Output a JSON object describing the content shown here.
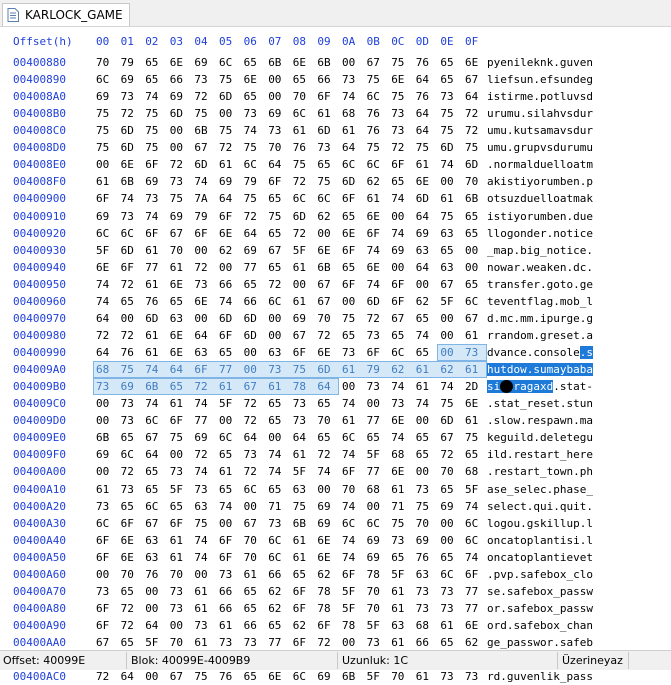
{
  "tab": {
    "title": "KARLOCK_GAME",
    "icon": "document-icon"
  },
  "header": {
    "offset_label": "Offset(h)",
    "columns": [
      "00",
      "01",
      "02",
      "03",
      "04",
      "05",
      "06",
      "07",
      "08",
      "09",
      "0A",
      "0B",
      "0C",
      "0D",
      "0E",
      "0F"
    ]
  },
  "rows": [
    {
      "offset": "00400880",
      "bytes": [
        "70",
        "79",
        "65",
        "6E",
        "69",
        "6C",
        "65",
        "6B",
        "6E",
        "6B",
        "00",
        "67",
        "75",
        "76",
        "65",
        "6E"
      ],
      "ascii": "pyenileknk.guven"
    },
    {
      "offset": "00400890",
      "bytes": [
        "6C",
        "69",
        "65",
        "66",
        "73",
        "75",
        "6E",
        "00",
        "65",
        "66",
        "73",
        "75",
        "6E",
        "64",
        "65",
        "67"
      ],
      "ascii": "liefsun.efsundeg"
    },
    {
      "offset": "004008A0",
      "bytes": [
        "69",
        "73",
        "74",
        "69",
        "72",
        "6D",
        "65",
        "00",
        "70",
        "6F",
        "74",
        "6C",
        "75",
        "76",
        "73",
        "64"
      ],
      "ascii": "istirme.potluvsd"
    },
    {
      "offset": "004008B0",
      "bytes": [
        "75",
        "72",
        "75",
        "6D",
        "75",
        "00",
        "73",
        "69",
        "6C",
        "61",
        "68",
        "76",
        "73",
        "64",
        "75",
        "72"
      ],
      "ascii": "urumu.silahvsdur"
    },
    {
      "offset": "004008C0",
      "bytes": [
        "75",
        "6D",
        "75",
        "00",
        "6B",
        "75",
        "74",
        "73",
        "61",
        "6D",
        "61",
        "76",
        "73",
        "64",
        "75",
        "72"
      ],
      "ascii": "umu.kutsamavsdur"
    },
    {
      "offset": "004008D0",
      "bytes": [
        "75",
        "6D",
        "75",
        "00",
        "67",
        "72",
        "75",
        "70",
        "76",
        "73",
        "64",
        "75",
        "72",
        "75",
        "6D",
        "75"
      ],
      "ascii": "umu.grupvsdurumu"
    },
    {
      "offset": "004008E0",
      "bytes": [
        "00",
        "6E",
        "6F",
        "72",
        "6D",
        "61",
        "6C",
        "64",
        "75",
        "65",
        "6C",
        "6C",
        "6F",
        "61",
        "74",
        "6D"
      ],
      "ascii": ".normalduelloatm"
    },
    {
      "offset": "004008F0",
      "bytes": [
        "61",
        "6B",
        "69",
        "73",
        "74",
        "69",
        "79",
        "6F",
        "72",
        "75",
        "6D",
        "62",
        "65",
        "6E",
        "00",
        "70"
      ],
      "ascii": "akistiyorumben.p"
    },
    {
      "offset": "00400900",
      "bytes": [
        "6F",
        "74",
        "73",
        "75",
        "7A",
        "64",
        "75",
        "65",
        "6C",
        "6C",
        "6F",
        "61",
        "74",
        "6D",
        "61",
        "6B"
      ],
      "ascii": "otsuzduelloatmak"
    },
    {
      "offset": "00400910",
      "bytes": [
        "69",
        "73",
        "74",
        "69",
        "79",
        "6F",
        "72",
        "75",
        "6D",
        "62",
        "65",
        "6E",
        "00",
        "64",
        "75",
        "65"
      ],
      "ascii": "istiyorumben.due"
    },
    {
      "offset": "00400920",
      "bytes": [
        "6C",
        "6C",
        "6F",
        "67",
        "6F",
        "6E",
        "64",
        "65",
        "72",
        "00",
        "6E",
        "6F",
        "74",
        "69",
        "63",
        "65"
      ],
      "ascii": "llogonder.notice"
    },
    {
      "offset": "00400930",
      "bytes": [
        "5F",
        "6D",
        "61",
        "70",
        "00",
        "62",
        "69",
        "67",
        "5F",
        "6E",
        "6F",
        "74",
        "69",
        "63",
        "65",
        "00"
      ],
      "ascii": "_map.big_notice."
    },
    {
      "offset": "00400940",
      "bytes": [
        "6E",
        "6F",
        "77",
        "61",
        "72",
        "00",
        "77",
        "65",
        "61",
        "6B",
        "65",
        "6E",
        "00",
        "64",
        "63",
        "00"
      ],
      "ascii": "nowar.weaken.dc."
    },
    {
      "offset": "00400950",
      "bytes": [
        "74",
        "72",
        "61",
        "6E",
        "73",
        "66",
        "65",
        "72",
        "00",
        "67",
        "6F",
        "74",
        "6F",
        "00",
        "67",
        "65"
      ],
      "ascii": "transfer.goto.ge"
    },
    {
      "offset": "00400960",
      "bytes": [
        "74",
        "65",
        "76",
        "65",
        "6E",
        "74",
        "66",
        "6C",
        "61",
        "67",
        "00",
        "6D",
        "6F",
        "62",
        "5F",
        "6C"
      ],
      "ascii": "teventflag.mob_l"
    },
    {
      "offset": "00400970",
      "bytes": [
        "64",
        "00",
        "6D",
        "63",
        "00",
        "6D",
        "6D",
        "00",
        "69",
        "70",
        "75",
        "72",
        "67",
        "65",
        "00",
        "67"
      ],
      "ascii": "d.mc.mm.ipurge.g"
    },
    {
      "offset": "00400980",
      "bytes": [
        "72",
        "72",
        "61",
        "6E",
        "64",
        "6F",
        "6D",
        "00",
        "67",
        "72",
        "65",
        "73",
        "65",
        "74",
        "00",
        "61"
      ],
      "ascii": "rrandom.greset.a"
    },
    {
      "offset": "00400990",
      "bytes": [
        "64",
        "76",
        "61",
        "6E",
        "63",
        "65",
        "00",
        "63",
        "6F",
        "6E",
        "73",
        "6F",
        "6C",
        "65",
        "00",
        "73"
      ],
      "ascii": "dvance.console.s"
    },
    {
      "offset": "004009A0",
      "bytes": [
        "68",
        "75",
        "74",
        "64",
        "6F",
        "77",
        "00",
        "73",
        "75",
        "6D",
        "61",
        "79",
        "62",
        "61",
        "62",
        "61"
      ],
      "ascii": "hutdow.sumaybaba"
    },
    {
      "offset": "004009B0",
      "bytes": [
        "73",
        "69",
        "6B",
        "65",
        "72",
        "61",
        "67",
        "61",
        "78",
        "64",
        "00",
        "73",
        "74",
        "61",
        "74",
        "2D"
      ],
      "ascii": "siteragaxd.stat-"
    },
    {
      "offset": "004009C0",
      "bytes": [
        "00",
        "73",
        "74",
        "61",
        "74",
        "5F",
        "72",
        "65",
        "73",
        "65",
        "74",
        "00",
        "73",
        "74",
        "75",
        "6E"
      ],
      "ascii": ".stat_reset.stun"
    },
    {
      "offset": "004009D0",
      "bytes": [
        "00",
        "73",
        "6C",
        "6F",
        "77",
        "00",
        "72",
        "65",
        "73",
        "70",
        "61",
        "77",
        "6E",
        "00",
        "6D",
        "61"
      ],
      "ascii": ".slow.respawn.ma"
    },
    {
      "offset": "004009E0",
      "bytes": [
        "6B",
        "65",
        "67",
        "75",
        "69",
        "6C",
        "64",
        "00",
        "64",
        "65",
        "6C",
        "65",
        "74",
        "65",
        "67",
        "75"
      ],
      "ascii": "keguild.deletegu"
    },
    {
      "offset": "004009F0",
      "bytes": [
        "69",
        "6C",
        "64",
        "00",
        "72",
        "65",
        "73",
        "74",
        "61",
        "72",
        "74",
        "5F",
        "68",
        "65",
        "72",
        "65"
      ],
      "ascii": "ild.restart_here"
    },
    {
      "offset": "00400A00",
      "bytes": [
        "00",
        "72",
        "65",
        "73",
        "74",
        "61",
        "72",
        "74",
        "5F",
        "74",
        "6F",
        "77",
        "6E",
        "00",
        "70",
        "68"
      ],
      "ascii": ".restart_town.ph"
    },
    {
      "offset": "00400A10",
      "bytes": [
        "61",
        "73",
        "65",
        "5F",
        "73",
        "65",
        "6C",
        "65",
        "63",
        "00",
        "70",
        "68",
        "61",
        "73",
        "65",
        "5F"
      ],
      "ascii": "ase_selec.phase_"
    },
    {
      "offset": "00400A20",
      "bytes": [
        "73",
        "65",
        "6C",
        "65",
        "63",
        "74",
        "00",
        "71",
        "75",
        "69",
        "74",
        "00",
        "71",
        "75",
        "69",
        "74"
      ],
      "ascii": "select.qui.quit."
    },
    {
      "offset": "00400A30",
      "bytes": [
        "6C",
        "6F",
        "67",
        "6F",
        "75",
        "00",
        "67",
        "73",
        "6B",
        "69",
        "6C",
        "6C",
        "75",
        "70",
        "00",
        "6C"
      ],
      "ascii": "logou.gskillup.l"
    },
    {
      "offset": "00400A40",
      "bytes": [
        "6F",
        "6E",
        "63",
        "61",
        "74",
        "6F",
        "70",
        "6C",
        "61",
        "6E",
        "74",
        "69",
        "73",
        "69",
        "00",
        "6C"
      ],
      "ascii": "oncatoplantisi.l"
    },
    {
      "offset": "00400A50",
      "bytes": [
        "6F",
        "6E",
        "63",
        "61",
        "74",
        "6F",
        "70",
        "6C",
        "61",
        "6E",
        "74",
        "69",
        "65",
        "76",
        "65",
        "74"
      ],
      "ascii": "oncatoplantievet"
    },
    {
      "offset": "00400A60",
      "bytes": [
        "00",
        "70",
        "76",
        "70",
        "00",
        "73",
        "61",
        "66",
        "65",
        "62",
        "6F",
        "78",
        "5F",
        "63",
        "6C",
        "6F"
      ],
      "ascii": ".pvp.safebox_clo"
    },
    {
      "offset": "00400A70",
      "bytes": [
        "73",
        "65",
        "00",
        "73",
        "61",
        "66",
        "65",
        "62",
        "6F",
        "78",
        "5F",
        "70",
        "61",
        "73",
        "73",
        "77"
      ],
      "ascii": "se.safebox_passw"
    },
    {
      "offset": "00400A80",
      "bytes": [
        "6F",
        "72",
        "00",
        "73",
        "61",
        "66",
        "65",
        "62",
        "6F",
        "78",
        "5F",
        "70",
        "61",
        "73",
        "73",
        "77"
      ],
      "ascii": "or.safebox_passw"
    },
    {
      "offset": "00400A90",
      "bytes": [
        "6F",
        "72",
        "64",
        "00",
        "73",
        "61",
        "66",
        "65",
        "62",
        "6F",
        "78",
        "5F",
        "63",
        "68",
        "61",
        "6E"
      ],
      "ascii": "ord.safebox_chan"
    },
    {
      "offset": "00400AA0",
      "bytes": [
        "67",
        "65",
        "5F",
        "70",
        "61",
        "73",
        "73",
        "77",
        "6F",
        "72",
        "00",
        "73",
        "61",
        "66",
        "65",
        "62"
      ],
      "ascii": "ge_passwor.safeb"
    },
    {
      "offset": "00400AB0",
      "bytes": [
        "6F",
        "78",
        "5F",
        "63",
        "68",
        "61",
        "6E",
        "67",
        "65",
        "5F",
        "70",
        "61",
        "73",
        "73",
        "77",
        "6F"
      ],
      "ascii": "ox_change_passwo"
    },
    {
      "offset": "00400AC0",
      "bytes": [
        "72",
        "64",
        "00",
        "67",
        "75",
        "76",
        "65",
        "6E",
        "6C",
        "69",
        "6B",
        "5F",
        "70",
        "61",
        "73",
        "73"
      ],
      "ascii": "rd.guvenlik_pass"
    }
  ],
  "selection": {
    "color": "#1e7ad8",
    "hex_fill": "#d5e8f8"
  },
  "status": {
    "offset": "Offset: 40099E",
    "block": "Blok: 40099E-4009B9",
    "length": "Uzunluk: 1C",
    "mode": "Üzerineyaz"
  }
}
